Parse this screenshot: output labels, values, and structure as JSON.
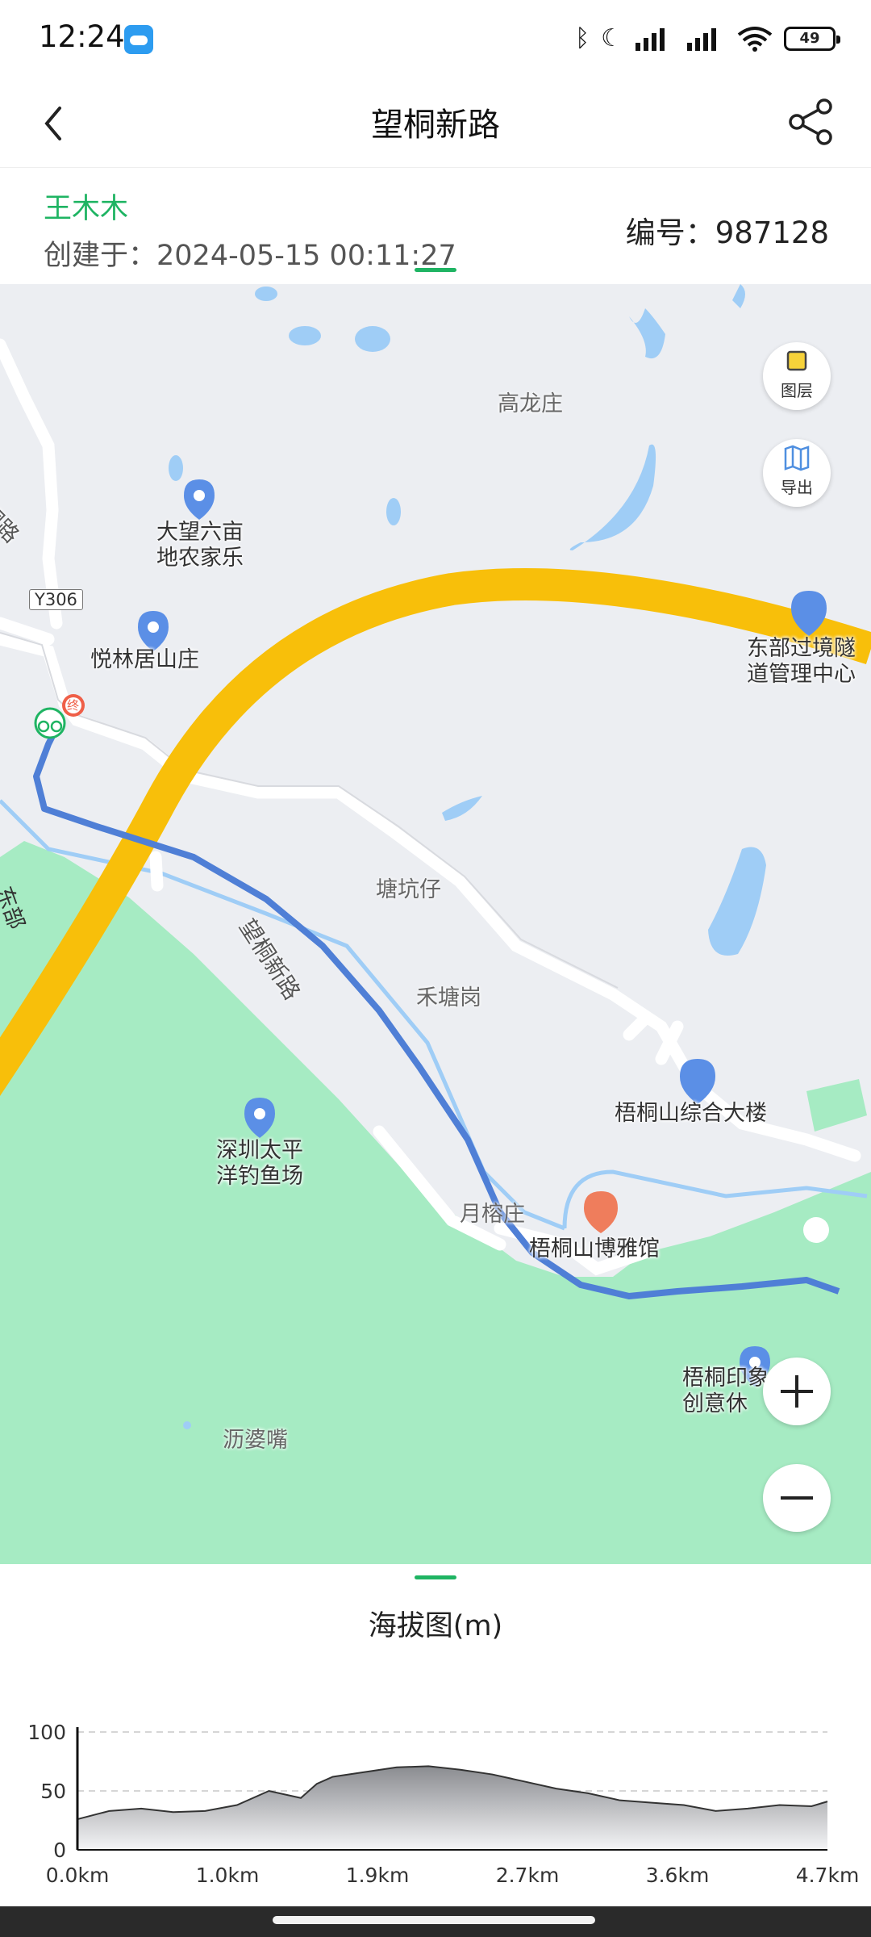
{
  "status_bar": {
    "time": "12:24",
    "battery": "49"
  },
  "header": {
    "title": "望桐新路"
  },
  "info": {
    "author": "王木木",
    "created_label": "创建于：",
    "created_at": "2024-05-15 00:11:27",
    "number_label": "编号：",
    "number": "987128"
  },
  "map": {
    "controls": {
      "layers_label": "图层",
      "export_label": "导出"
    },
    "place_labels": [
      "高龙庄",
      "塘坑仔",
      "禾塘岗",
      "月榕庄",
      "沥婆嘴"
    ],
    "pois": [
      "大望六亩\n地农家乐",
      "悦林居山庄",
      "东部过境隧\n道管理中心",
      "梧桐山综合大楼",
      "深圳太平\n洋钓鱼场",
      "梧桐山博雅馆",
      "梧桐印象\n创意休"
    ],
    "road_labels": {
      "y306": "Y306",
      "route": "望桐新路",
      "left_edge": "桐路",
      "left_highway": "东部"
    },
    "markers": {
      "end": "终"
    },
    "colors": {
      "route": "#4f7fd6",
      "highway": "#f8bf0a",
      "green": "#a6ebc3",
      "water": "#9fcdf6",
      "accent": "#1fb463"
    }
  },
  "elevation": {
    "title": "海拔图(m)",
    "chart_data": {
      "type": "area",
      "title": "海拔图(m)",
      "ylim": [
        0,
        100
      ],
      "y_ticks": [
        "100",
        "50",
        "0"
      ],
      "x_ticks": [
        "0.0km",
        "1.0km",
        "1.9km",
        "2.7km",
        "3.6km",
        "4.7km"
      ],
      "grid": true,
      "x": [
        0.0,
        0.2,
        0.4,
        0.6,
        0.8,
        1.0,
        1.2,
        1.4,
        1.5,
        1.6,
        1.8,
        2.0,
        2.2,
        2.4,
        2.6,
        2.8,
        3.0,
        3.2,
        3.4,
        3.6,
        3.8,
        4.0,
        4.2,
        4.4,
        4.6,
        4.7
      ],
      "y": [
        26,
        33,
        35,
        32,
        33,
        38,
        50,
        44,
        56,
        62,
        66,
        70,
        71,
        68,
        64,
        58,
        52,
        48,
        42,
        40,
        38,
        33,
        35,
        38,
        37,
        41
      ]
    }
  }
}
